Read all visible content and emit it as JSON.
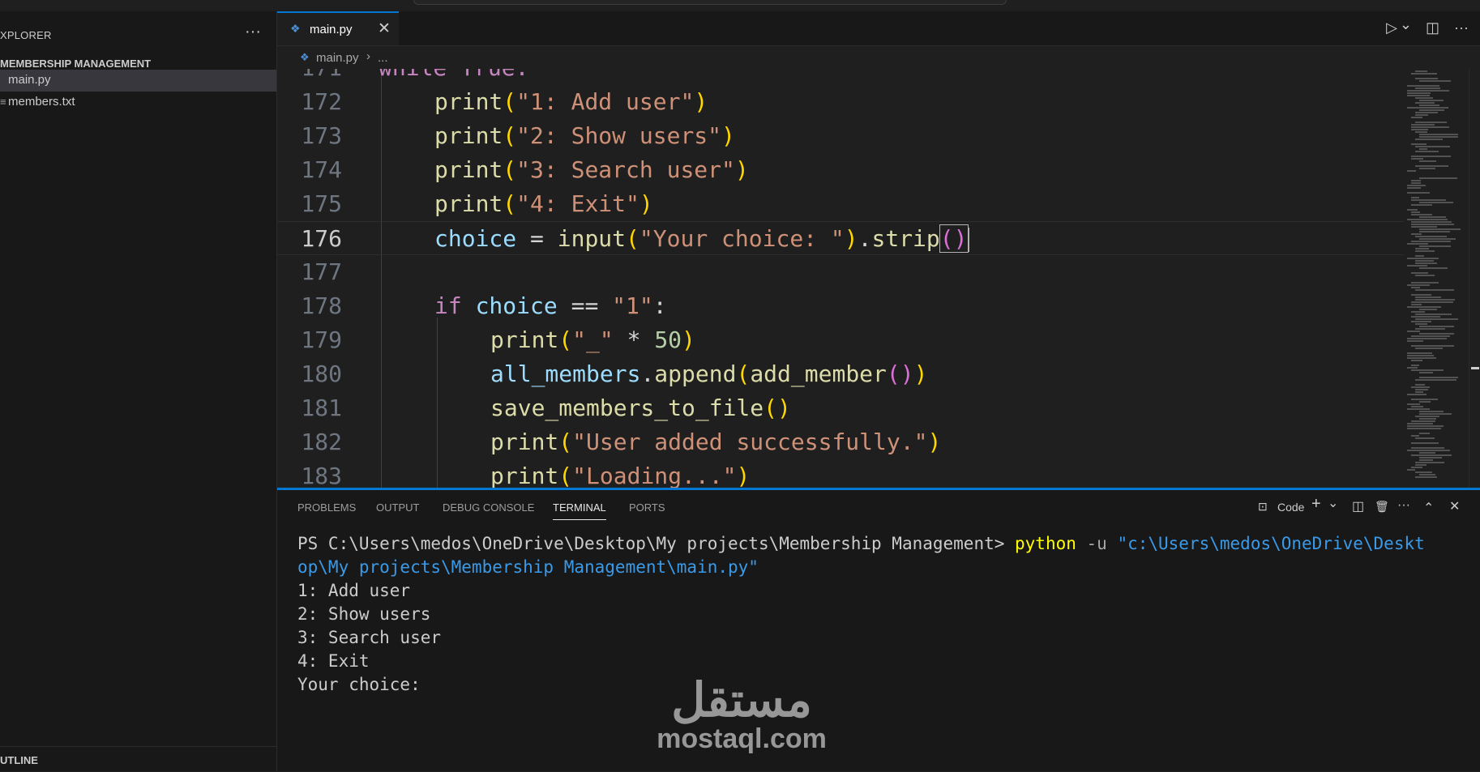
{
  "sidebar": {
    "title": "XPLORER",
    "more": "···",
    "folder": "MEMBERSHIP MANAGEMENT",
    "files": [
      {
        "name": "main.py",
        "icon": "python-file-icon",
        "active": true
      },
      {
        "name": "members.txt",
        "icon": "text-file-icon",
        "active": false
      }
    ],
    "outline": "UTLINE"
  },
  "editor": {
    "tab": {
      "label": "main.py",
      "close": "✕"
    },
    "breadcrumb": {
      "file": "main.py",
      "sep": "›",
      "more": "..."
    },
    "actions": {
      "run": "▷",
      "run_dropdown": "⌄",
      "split": "◫",
      "more": "···"
    },
    "partial_line": "while True:",
    "lines": [
      {
        "n": "172",
        "indent": 1,
        "code": "print(\"1: Add user\")"
      },
      {
        "n": "173",
        "indent": 1,
        "code": "print(\"2: Show users\")"
      },
      {
        "n": "174",
        "indent": 1,
        "code": "print(\"3: Search user\")"
      },
      {
        "n": "175",
        "indent": 1,
        "code": "print(\"4: Exit\")"
      },
      {
        "n": "176",
        "indent": 1,
        "code": "choice = input(\"Your choice: \").strip()"
      },
      {
        "n": "177",
        "indent": 0,
        "code": ""
      },
      {
        "n": "178",
        "indent": 1,
        "code": "if choice == \"1\":"
      },
      {
        "n": "179",
        "indent": 2,
        "code": "print(\"_\" * 50)"
      },
      {
        "n": "180",
        "indent": 2,
        "code": "all_members.append(add_member())"
      },
      {
        "n": "181",
        "indent": 2,
        "code": "save_members_to_file()"
      },
      {
        "n": "182",
        "indent": 2,
        "code": "print(\"User added successfully.\")"
      },
      {
        "n": "183",
        "indent": 2,
        "code": "print(\"Loading...\")"
      }
    ],
    "current_line": "176"
  },
  "panel": {
    "tabs": [
      "PROBLEMS",
      "OUTPUT",
      "DEBUG CONSOLE",
      "TERMINAL",
      "PORTS"
    ],
    "active_tab": "TERMINAL",
    "terminal_name": "Code",
    "actions": {
      "new": "+",
      "dropdown": "⌄",
      "split": "◫",
      "kill": "🗑",
      "more": "···",
      "maximize": "⌃",
      "close": "✕"
    },
    "terminal": {
      "prompt": "PS C:\\Users\\medos\\OneDrive\\Desktop\\My projects\\Membership Management> ",
      "cmd": "python",
      "flag": " -u ",
      "path1": "\"c:\\Users\\medos\\OneDrive\\Deskt",
      "path2": "op\\My projects\\Membership Management\\main.py\"",
      "output": [
        "1: Add user",
        "2: Show users",
        "3: Search user",
        "4: Exit",
        "Your choice:"
      ]
    }
  },
  "watermark": {
    "arabic": "مستقل",
    "latin": "mostaql.com"
  },
  "colors": {
    "accent": "#0078d4",
    "editor_bg": "#1f1f1f",
    "sidebar_bg": "#181818"
  }
}
